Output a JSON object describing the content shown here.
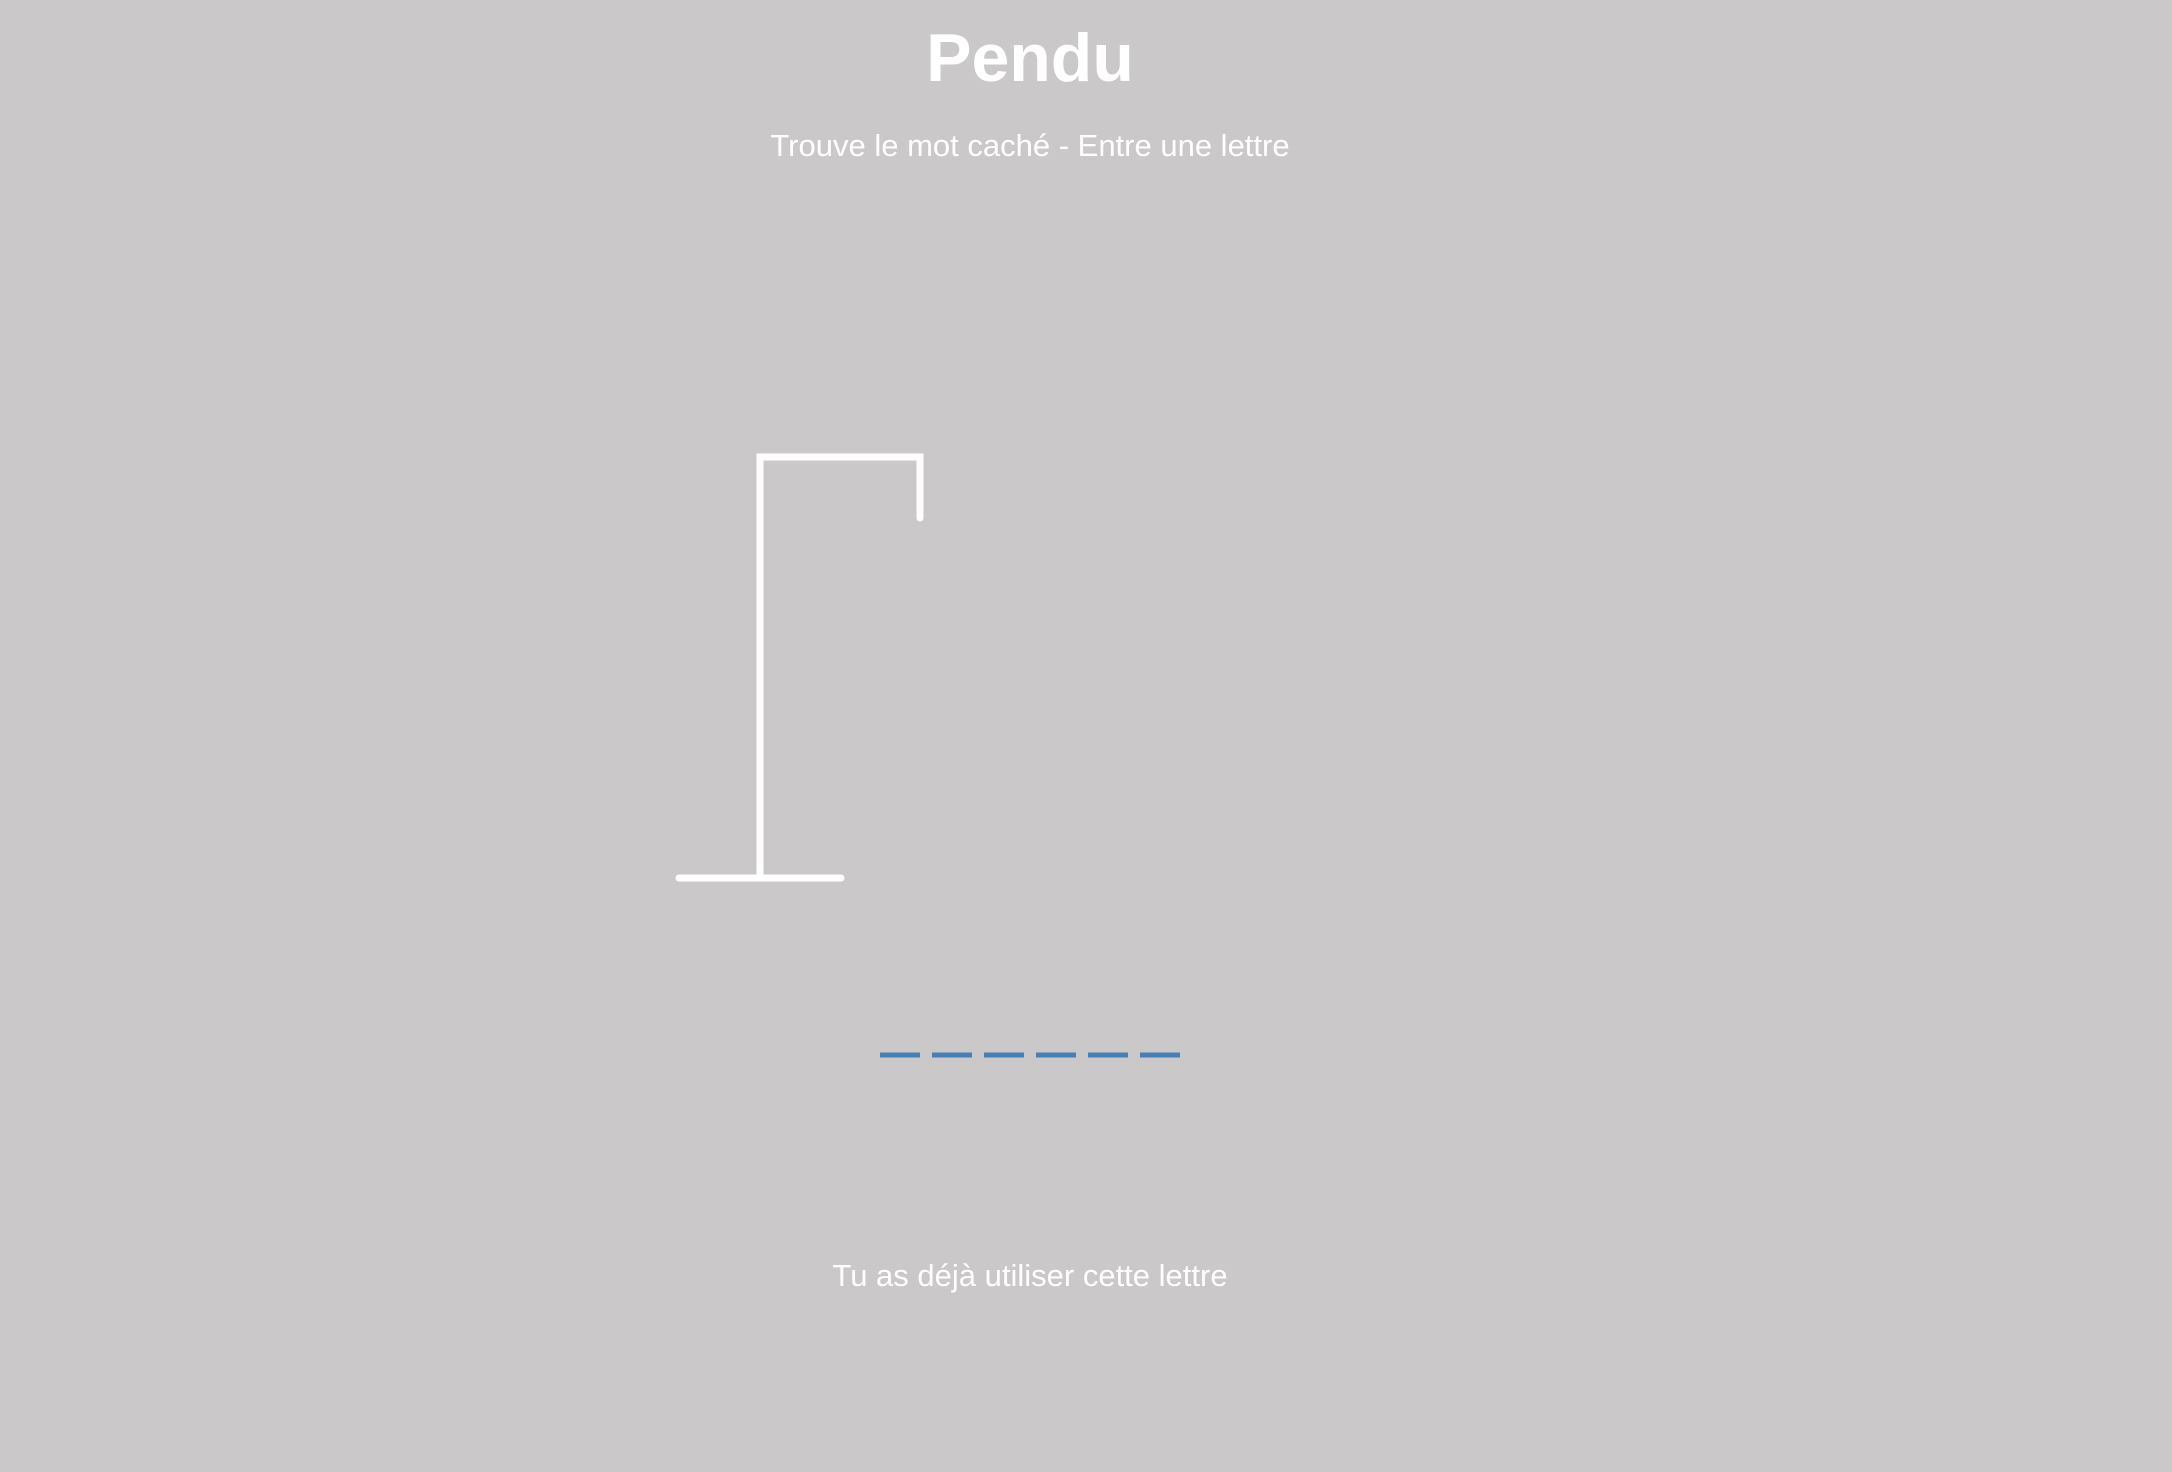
{
  "game": {
    "title": "Pendu",
    "subtitle": "Trouve le mot caché - Entre une lettre",
    "status_message": "Tu as déjà utiliser cette lettre"
  },
  "word": {
    "letter_count": 6,
    "revealed": [
      "",
      "",
      "",
      "",
      "",
      ""
    ]
  },
  "hangman": {
    "errors": 4,
    "parts_drawn": [
      "base",
      "pole",
      "beam",
      "rope"
    ]
  },
  "colors": {
    "background": "#cac8c9",
    "text": "#ffffff",
    "gallows": "#ffffff",
    "slot": "#4a7fb5"
  }
}
